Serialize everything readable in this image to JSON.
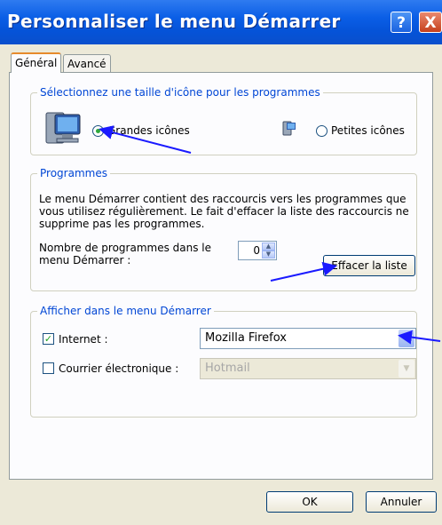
{
  "window": {
    "title": "Personnaliser le menu Démarrer",
    "help_glyph": "?",
    "close_glyph": "X"
  },
  "tabs": [
    {
      "label": "Général",
      "active": true
    },
    {
      "label": "Avancé",
      "active": false
    }
  ],
  "icon_size": {
    "legend": "Sélectionnez une taille d'icône pour les programmes",
    "large_icons_label": "Grandes icônes",
    "small_icons_label": "Petites icônes",
    "selected": "large"
  },
  "programs": {
    "legend": "Programmes",
    "description": [
      "Le menu Démarrer contient des raccourcis vers les programmes que",
      "vous utilisez régulièrement. Le fait d'effacer la liste des raccourcis ne",
      "supprime pas les programmes."
    ],
    "count_label": [
      "Nombre de programmes dans le",
      "menu Démarrer :"
    ],
    "count_value": "0",
    "clear_button": "Effacer la liste"
  },
  "show_in_menu": {
    "legend": "Afficher dans le menu Démarrer",
    "internet": {
      "label": "Internet :",
      "checked": true,
      "value": "Mozilla Firefox"
    },
    "email": {
      "label": "Courrier électronique :",
      "checked": false,
      "value": "Hotmail"
    }
  },
  "footer": {
    "ok_label": "OK",
    "cancel_label": "Annuler"
  },
  "colors": {
    "titlebar": "#0a5ee6",
    "legend_text": "#0046d5",
    "annotation_arrows": "#1a1aff"
  }
}
